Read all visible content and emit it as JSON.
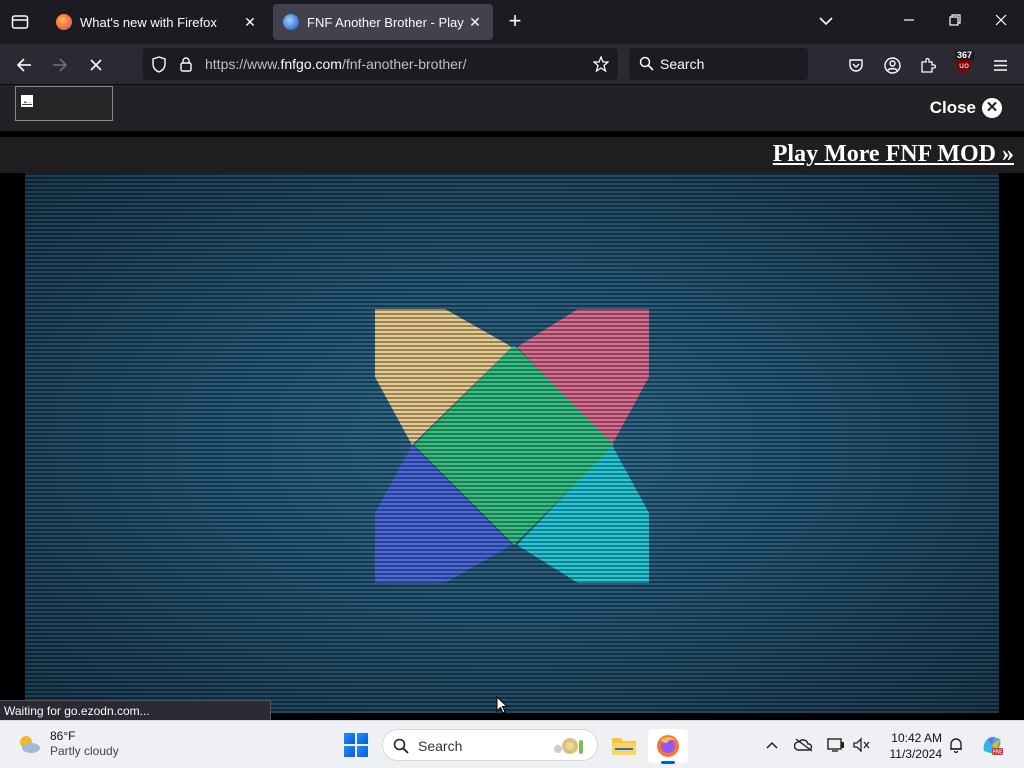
{
  "browser": {
    "tabs": [
      {
        "title": "What's new with Firefox",
        "active": false
      },
      {
        "title": "FNF Another Brother - Play Onl",
        "active": true
      }
    ],
    "url_prefix": "https://www.",
    "url_host": "fnfgo.com",
    "url_path": "/fnf-another-brother/",
    "search_label": "Search",
    "extension_badge": "367",
    "status_text": "Waiting for go.ezodn.com...",
    "colors": {
      "toolbar": "#2b2a33",
      "tabstrip": "#1c1b22"
    }
  },
  "page": {
    "close_label": "Close",
    "play_more_label": "Play More FNF MOD »",
    "game_colors": {
      "yellow": "#e8c98a",
      "pink": "#d8678e",
      "green": "#2fbe7e",
      "blue": "#4463d8",
      "cyan": "#1fc6d8",
      "bg": "#1f5272"
    }
  },
  "taskbar": {
    "temperature": "86°F",
    "condition": "Partly cloudy",
    "search_label": "Search",
    "time": "10:42 AM",
    "date": "11/3/2024"
  }
}
